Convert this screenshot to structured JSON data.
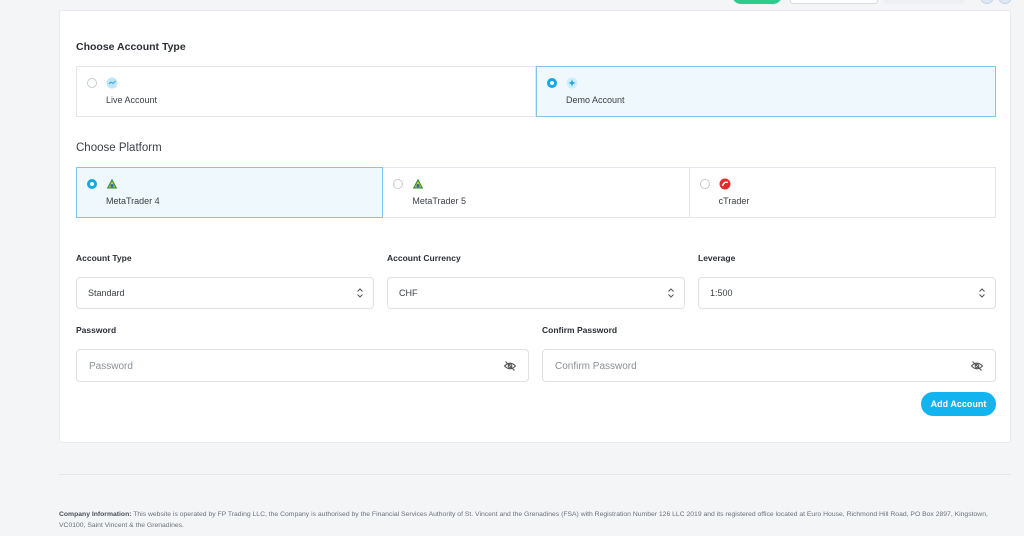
{
  "account_type_section": {
    "title": "Choose Account Type",
    "options": [
      {
        "label": "Live Account",
        "selected": false,
        "icon": "live-account-icon"
      },
      {
        "label": "Demo Account",
        "selected": true,
        "icon": "demo-account-icon"
      }
    ]
  },
  "platform_section": {
    "title": "Choose Platform",
    "options": [
      {
        "label": "MetaTrader 4",
        "selected": true,
        "icon": "metatrader-4-icon"
      },
      {
        "label": "MetaTrader 5",
        "selected": false,
        "icon": "metatrader-5-icon"
      },
      {
        "label": "cTrader",
        "selected": false,
        "icon": "ctrader-icon"
      }
    ]
  },
  "form": {
    "account_type": {
      "label": "Account Type",
      "value": "Standard"
    },
    "account_currency": {
      "label": "Account Currency",
      "value": "CHF"
    },
    "leverage": {
      "label": "Leverage",
      "value": "1:500"
    },
    "password": {
      "label": "Password",
      "placeholder": "Password"
    },
    "confirm_password": {
      "label": "Confirm Password",
      "placeholder": "Confirm Password"
    },
    "submit_label": "Add Account"
  },
  "footer": {
    "heading": "Company Information:",
    "text": "This website is operated by FP Trading LLC, the Company is authorised by the Financial Services Authority of St. Vincent and the Grenadines (FSA) with Registration Number 126 LLC 2019 and its registered office located at Euro House, Richmond Hill Road, PO Box 2897, Kingstown, VC0100, Saint Vincent & the Grenadines."
  },
  "colors": {
    "accent": "#12b4ef",
    "selected_bg": "#eef8fd",
    "selected_border": "#7cc7ea",
    "top_button": "#2ecc8b"
  }
}
